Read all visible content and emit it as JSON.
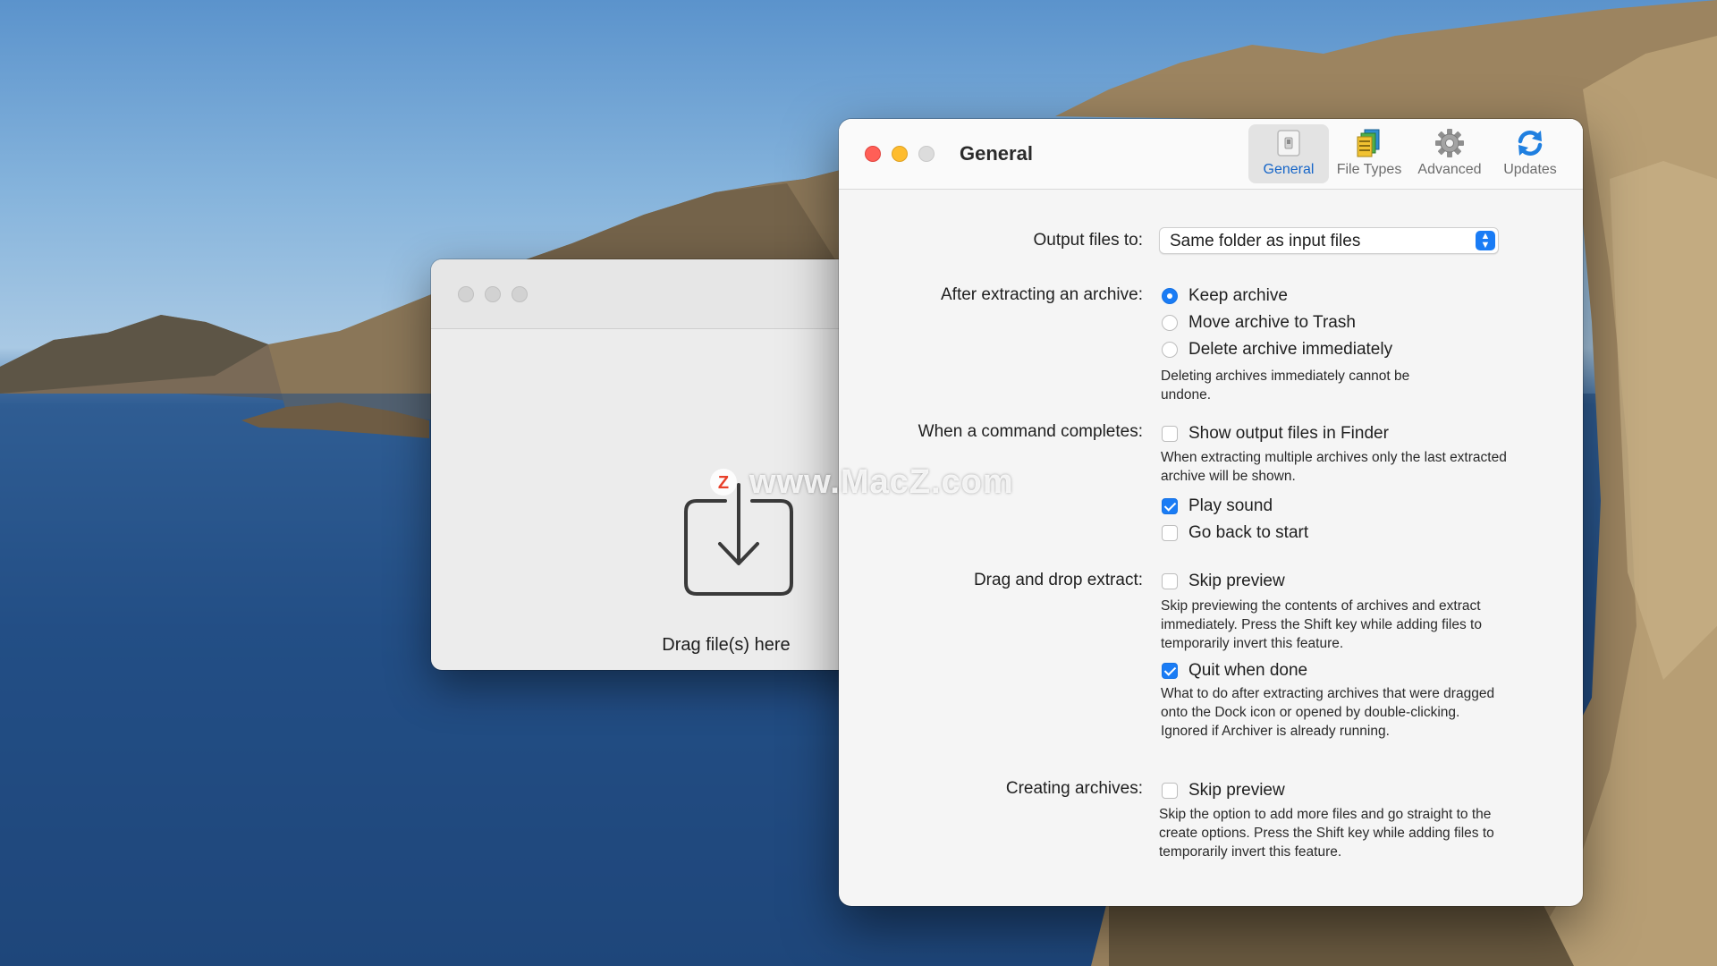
{
  "watermark": {
    "text": "www.MacZ.com"
  },
  "main_window": {
    "drop_label": "Drag file(s) here"
  },
  "prefs": {
    "title": "General",
    "tabs": [
      {
        "label": "General",
        "icon": "general-switch-icon",
        "active": true
      },
      {
        "label": "File Types",
        "icon": "file-types-icon",
        "active": false
      },
      {
        "label": "Advanced",
        "icon": "gear-icon",
        "active": false
      },
      {
        "label": "Updates",
        "icon": "refresh-icon",
        "active": false
      }
    ],
    "output": {
      "label": "Output files to:",
      "value": "Same folder as input files"
    },
    "after_extract": {
      "label": "After extracting an archive:",
      "options": [
        "Keep archive",
        "Move archive to Trash",
        "Delete archive immediately"
      ],
      "selected": "Keep archive",
      "note": "Deleting archives immediately cannot be undone."
    },
    "command_completes": {
      "label": "When a command completes:",
      "show_output": {
        "label": "Show output files in Finder",
        "checked": false
      },
      "show_output_note": "When extracting multiple archives only the last extracted archive will be shown.",
      "play_sound": {
        "label": "Play sound",
        "checked": true
      },
      "go_back": {
        "label": "Go back to start",
        "checked": false
      }
    },
    "drag_drop": {
      "label": "Drag and drop extract:",
      "skip_preview": {
        "label": "Skip preview",
        "checked": false
      },
      "skip_note": "Skip previewing the contents of archives and extract immediately. Press the Shift key while adding files to temporarily invert this feature.",
      "quit_done": {
        "label": "Quit when done",
        "checked": true
      },
      "quit_note": "What to do after extracting archives that were dragged onto the Dock icon or opened by double-clicking. Ignored if Archiver is already running."
    },
    "creating": {
      "label": "Creating archives:",
      "skip_preview": {
        "label": "Skip preview",
        "checked": false
      },
      "skip_note": "Skip the option to add more files and go straight to the create options. Press the Shift key while adding files to temporarily invert this feature."
    }
  }
}
